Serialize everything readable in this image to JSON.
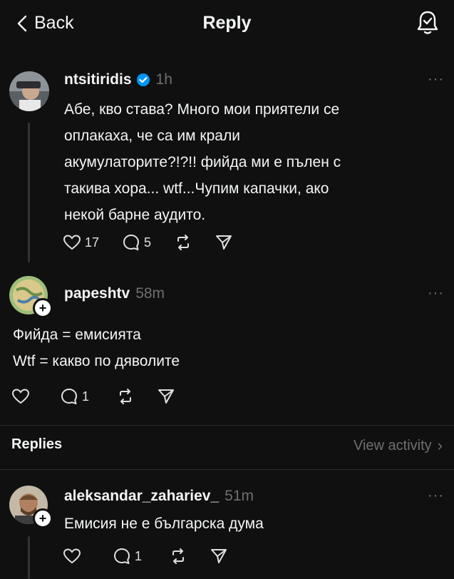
{
  "header": {
    "back_label": "Back",
    "title": "Reply"
  },
  "post": {
    "username": "ntsitiridis",
    "verified": true,
    "time": "1h",
    "text_lines": [
      "Абе, кво става? Много мои приятели се",
      "оплакаха, че са им крали",
      "акумулаторите?!?!! фийда ми е пълен с",
      "такива хора... wtf...Чупим капачки, ако",
      "некой барне аудито."
    ],
    "likes": "17",
    "replies": "5"
  },
  "reply_post": {
    "username": "papeshtv",
    "time": "58m",
    "text_lines": [
      "Фийда = емисията",
      "Wtf = какво по дяволите"
    ],
    "replies": "1"
  },
  "replies_section": {
    "title": "Replies",
    "view_activity": "View activity",
    "chevron": "›"
  },
  "comment": {
    "username": "aleksandar_zahariev_",
    "time": "51m",
    "text": "Емисия не е българска дума",
    "replies": "1"
  },
  "more_label": "···",
  "colors": {
    "background": "#101010",
    "verified": "#0095f6",
    "muted": "#777777",
    "divider": "#2a2a2a"
  }
}
